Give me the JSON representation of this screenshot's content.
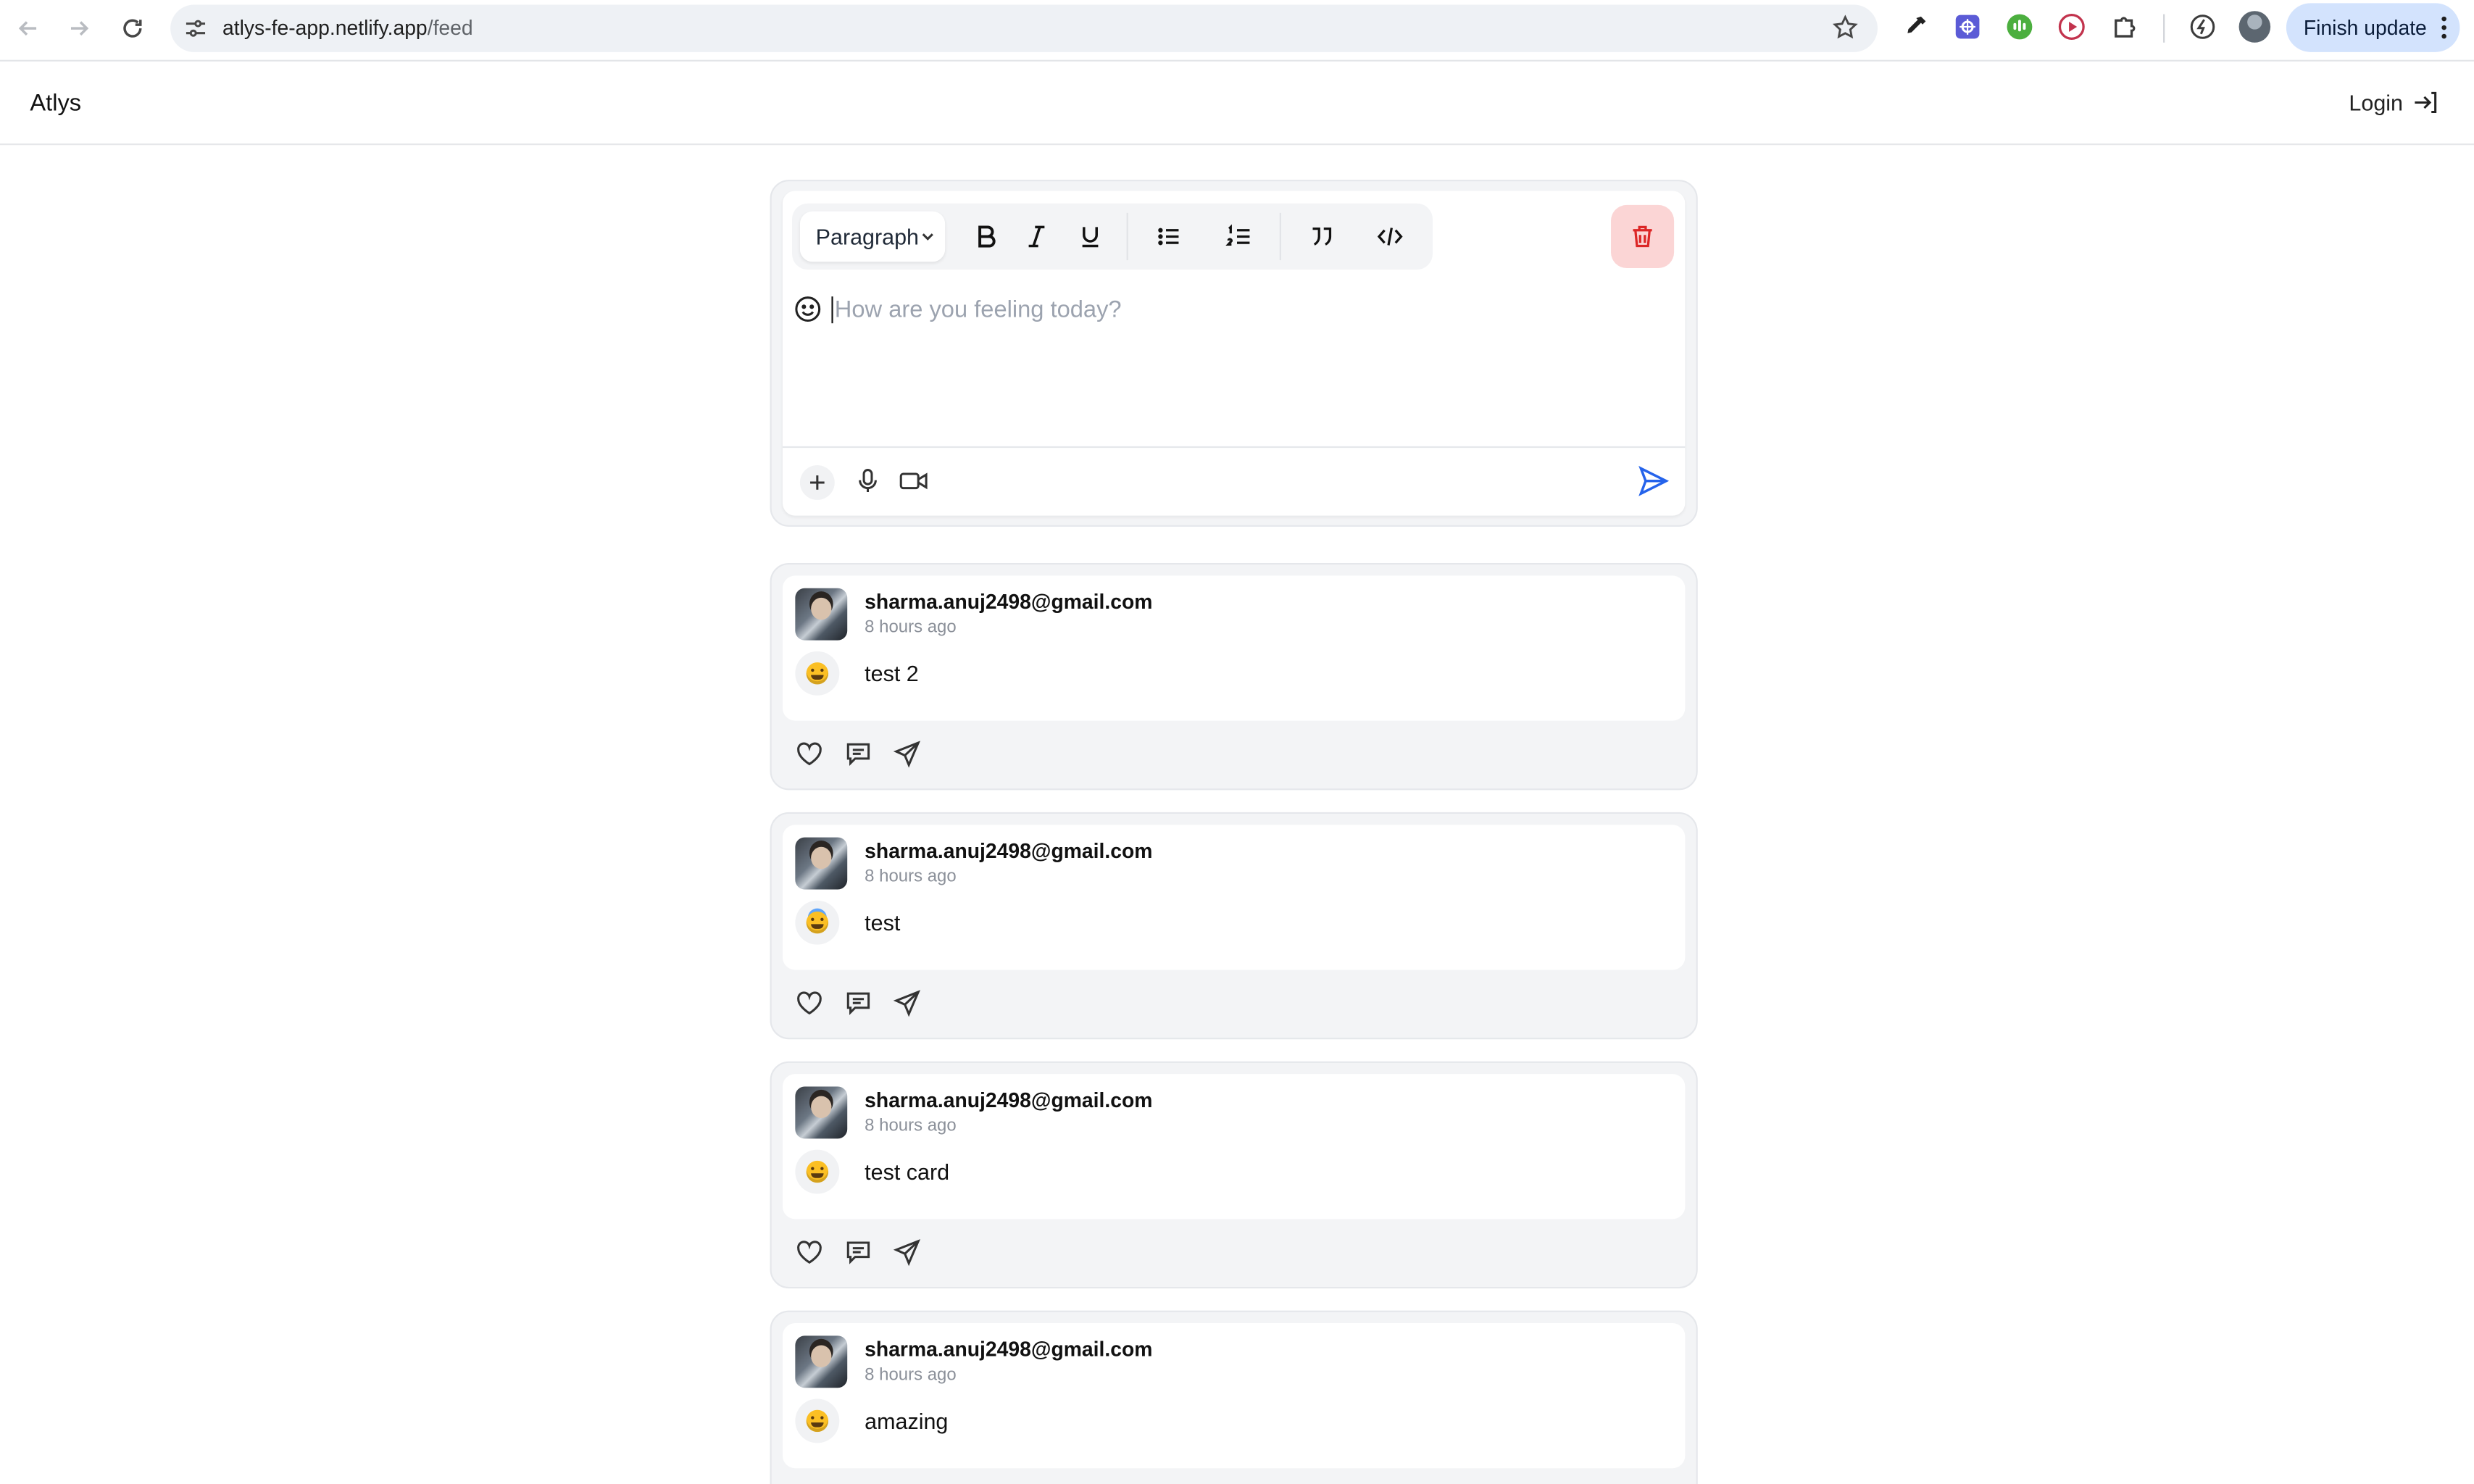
{
  "browser": {
    "url_host": "atlys-fe-app.netlify.app",
    "url_path": "/feed",
    "finish_update_label": "Finish update"
  },
  "header": {
    "brand": "Atlys",
    "login_label": "Login"
  },
  "composer": {
    "format_select": "Paragraph",
    "placeholder": "How are you feeling today?",
    "value": ""
  },
  "posts": [
    {
      "author": "sharma.anuj2498@gmail.com",
      "time": "8 hours ago",
      "text": "test 2",
      "mood": "grinning-face"
    },
    {
      "author": "sharma.anuj2498@gmail.com",
      "time": "8 hours ago",
      "text": "test",
      "mood": "smiling-face-with-halo"
    },
    {
      "author": "sharma.anuj2498@gmail.com",
      "time": "8 hours ago",
      "text": "test card",
      "mood": "face-savoring-food"
    },
    {
      "author": "sharma.anuj2498@gmail.com",
      "time": "8 hours ago",
      "text": "amazing",
      "mood": "grinning-face"
    }
  ],
  "icons": {
    "browser": [
      "back-icon",
      "forward-icon",
      "reload-icon",
      "site-settings-icon",
      "bookmark-star-icon",
      "eyedropper-icon",
      "extension-icon",
      "extensions-puzzle-icon",
      "lightning-icon",
      "more-vert-icon"
    ],
    "toolbar": [
      "bold-icon",
      "italic-icon",
      "underline-icon",
      "bulleted-list-icon",
      "numbered-list-icon",
      "quote-icon",
      "code-icon",
      "trash-icon"
    ],
    "post_actions": [
      "heart-icon",
      "comment-icon",
      "share-icon"
    ]
  },
  "colors": {
    "accent": "#2563eb",
    "delete_bg": "#fbd5d5",
    "delete_icon": "#dc2626",
    "card_bg": "#f3f4f6",
    "finish_update_bg": "#d3e3fd"
  }
}
